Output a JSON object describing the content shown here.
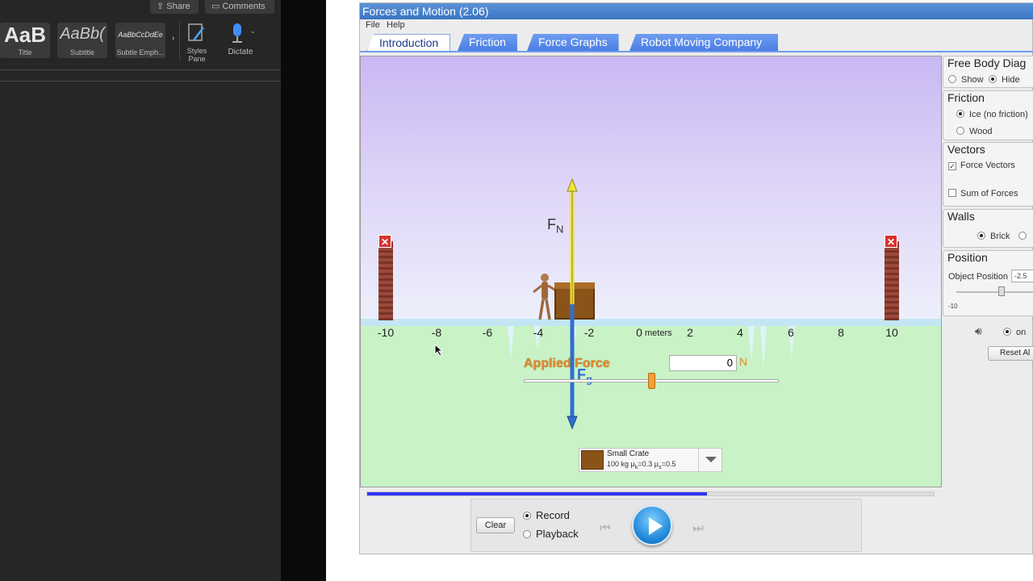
{
  "word": {
    "share_label": "Share",
    "comments_label": "Comments",
    "styles": [
      {
        "preview": "AaB",
        "name": "Title"
      },
      {
        "preview": "AaBb(",
        "name": "Subtitle"
      },
      {
        "preview": "AaBbCcDdEe",
        "name": "Subtle Emph..."
      }
    ],
    "styles_pane_label": "Styles Pane",
    "dictate_label": "Dictate"
  },
  "sim": {
    "title": "Forces and Motion (2.06)",
    "menu": {
      "file": "File",
      "help": "Help"
    },
    "tabs": [
      {
        "label": "Introduction",
        "active": true
      },
      {
        "label": "Friction",
        "active": false
      },
      {
        "label": "Force Graphs",
        "active": false
      },
      {
        "label": "Robot Moving Company",
        "active": false
      }
    ],
    "axis": {
      "ticks": [
        "-10",
        "-8",
        "-6",
        "-4",
        "-2",
        "0",
        "2",
        "4",
        "6",
        "8",
        "10"
      ],
      "unit": "meters"
    },
    "vectors": {
      "normal_label": "F",
      "normal_sub": "N",
      "gravity_label": "F",
      "gravity_sub": "g"
    },
    "applied_force": {
      "label": "Applied Force",
      "value": "0",
      "unit": "N",
      "slider_fraction": 0.5
    },
    "object": {
      "name": "Small Crate",
      "specs_mass": "100 kg",
      "mu_k": "=0.3",
      "mu_s": "=0.5"
    },
    "controls": {
      "clear_label": "Clear",
      "record_label": "Record",
      "playback_label": "Playback",
      "mode": "record",
      "progress_fraction": 0.6
    },
    "panel": {
      "fbd_title": "Free Body Diag",
      "fbd_show": "Show",
      "fbd_hide": "Hide",
      "friction_title": "Friction",
      "friction_ice": "Ice (no friction)",
      "friction_wood": "Wood",
      "vectors_title": "Vectors",
      "vectors_force": "Force Vectors",
      "vectors_sum": "Sum of Forces",
      "walls_title": "Walls",
      "walls_brick": "Brick",
      "position_title": "Position",
      "position_label": "Object Position",
      "position_value": "-2.5",
      "position_min": "-10",
      "sound_on": "on",
      "reset_label": "Reset Al"
    },
    "colors": {
      "normal_vector": "#f4e23a",
      "gravity_vector": "#2f6fd0",
      "applied_force": "#e08a2a",
      "tab_blue": "#4a7ee4"
    }
  }
}
